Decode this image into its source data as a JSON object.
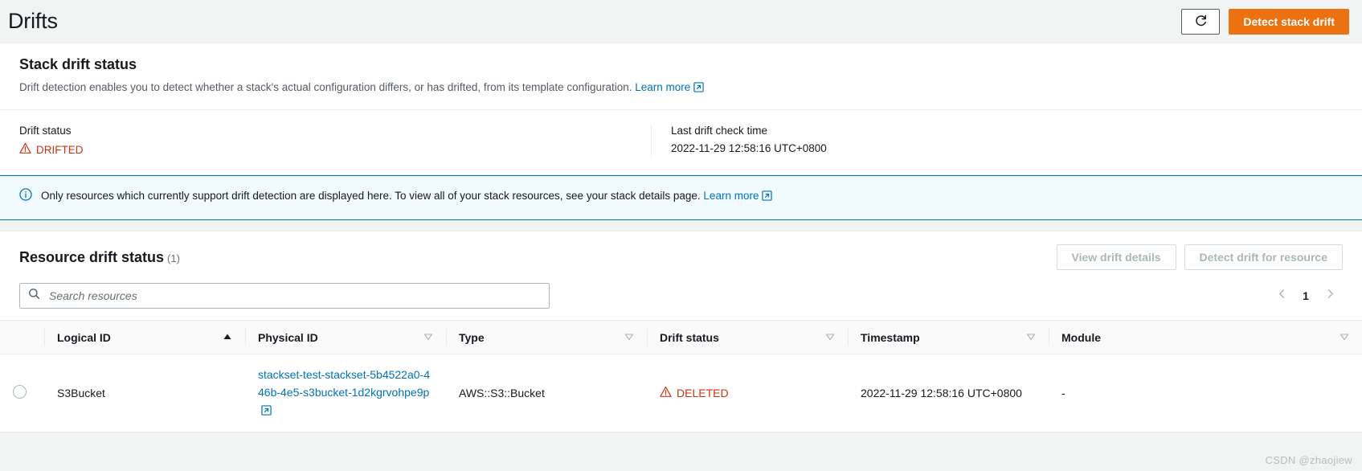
{
  "header": {
    "title": "Drifts",
    "refresh_icon": "refresh-icon",
    "refresh_label": "Refresh",
    "detect_stack_drift_label": "Detect stack drift"
  },
  "stack_drift": {
    "title": "Stack drift status",
    "description": "Drift detection enables you to detect whether a stack's actual configuration differs, or has drifted, from its template configuration.",
    "learn_more": "Learn more",
    "drift_status_label": "Drift status",
    "drift_status_value": "DRIFTED",
    "last_check_label": "Last drift check time",
    "last_check_value": "2022-11-29 12:58:16 UTC+0800"
  },
  "alert": {
    "icon": "info-icon",
    "text": "Only resources which currently support drift detection are displayed here. To view all of your stack resources, see your stack details page.",
    "learn_more": "Learn more"
  },
  "resource_table": {
    "title": "Resource drift status",
    "count": "(1)",
    "view_drift_details_label": "View drift details",
    "detect_drift_for_resource_label": "Detect drift for resource",
    "search": {
      "icon": "search-icon",
      "placeholder": "Search resources",
      "value": ""
    },
    "pagination": {
      "prev_icon": "chevron-left-icon",
      "next_icon": "chevron-right-icon",
      "current_page": "1"
    },
    "columns": [
      {
        "label": "Logical ID",
        "sort_icon": "sort-ascending-icon"
      },
      {
        "label": "Physical ID",
        "sort_icon": "sort-icon"
      },
      {
        "label": "Type",
        "sort_icon": "sort-icon"
      },
      {
        "label": "Drift status",
        "sort_icon": "sort-icon"
      },
      {
        "label": "Timestamp",
        "sort_icon": "sort-icon"
      },
      {
        "label": "Module",
        "sort_icon": "sort-icon"
      }
    ],
    "rows": [
      {
        "selected": false,
        "logical_id": "S3Bucket",
        "physical_id": "stackset-test-stackset-5b4522a0-446b-4e5-s3bucket-1d2kgrvohpe9p",
        "type": "AWS::S3::Bucket",
        "drift_status": "DELETED",
        "timestamp": "2022-11-29 12:58:16 UTC+0800",
        "module": "-"
      }
    ]
  },
  "watermark": "CSDN @zhaojiew",
  "colors": {
    "accent_orange": "#ec7211",
    "link_blue": "#0073bb",
    "danger_red": "#d13212",
    "page_bg": "#f2f3f3"
  }
}
